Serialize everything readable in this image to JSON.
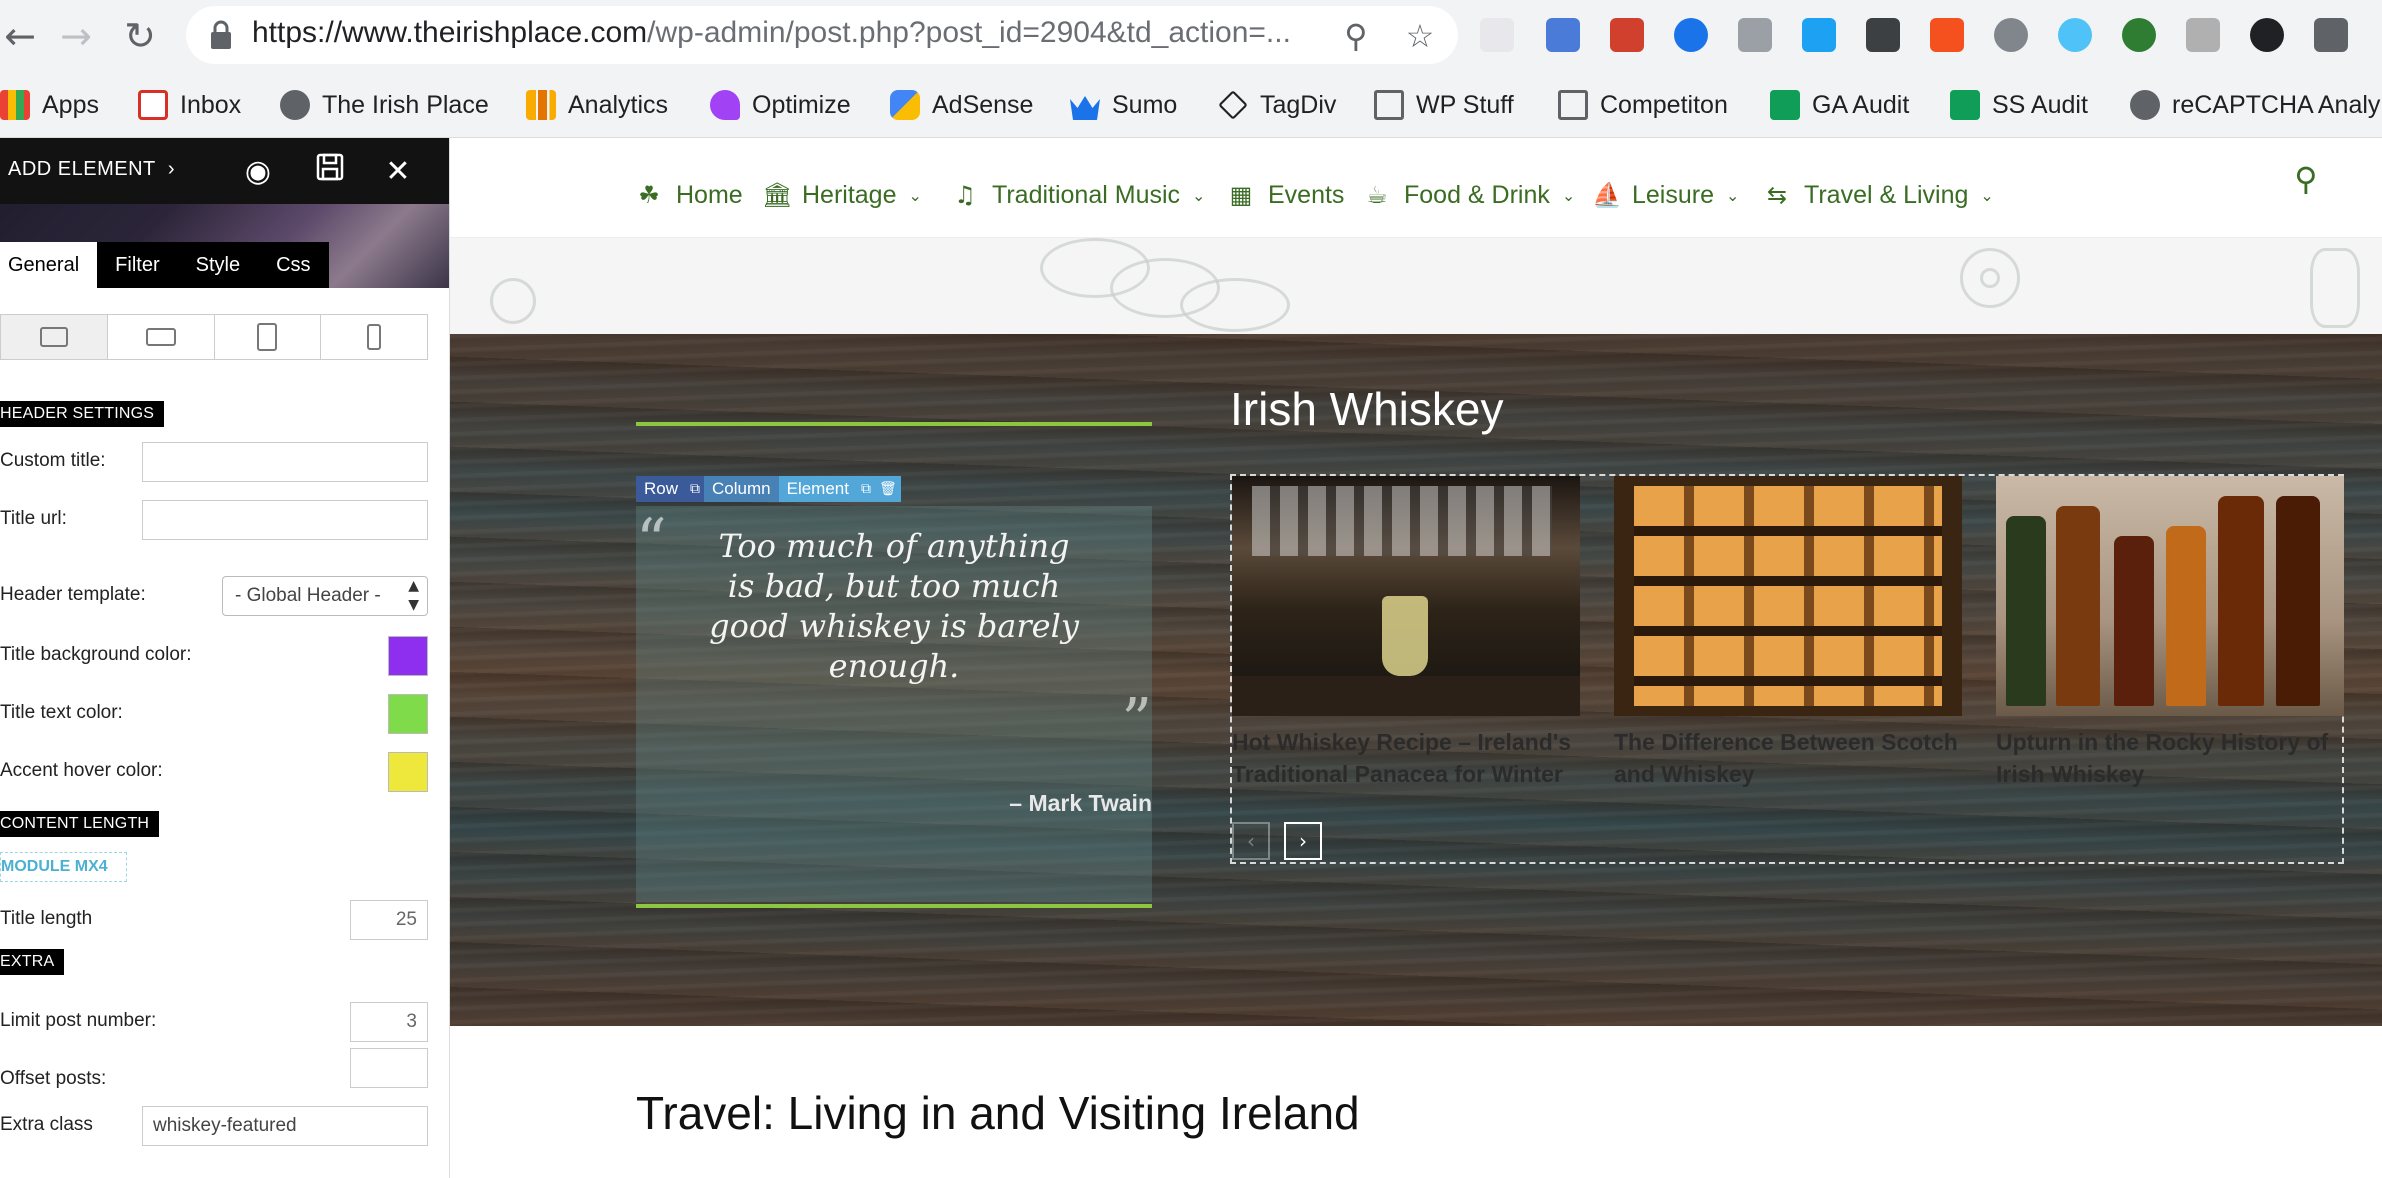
{
  "browser": {
    "url_host": "https://www.theirishplace.com",
    "url_path": "/wp-admin/post.php?post_id=2904&td_action=..."
  },
  "bookmarks": [
    {
      "label": "Apps",
      "icon": "apps-grid-icon",
      "color": "#e94235"
    },
    {
      "label": "Inbox",
      "icon": "gmail-icon",
      "color": "#d93025"
    },
    {
      "label": "The Irish Place",
      "icon": "globe-icon",
      "color": "#5f6368"
    },
    {
      "label": "Analytics",
      "icon": "analytics-icon",
      "color": "#f9ab00"
    },
    {
      "label": "Optimize",
      "icon": "optimize-icon",
      "color": "#a142f4"
    },
    {
      "label": "AdSense",
      "icon": "adsense-icon",
      "color": "#fbbc04"
    },
    {
      "label": "Sumo",
      "icon": "sumo-crown-icon",
      "color": "#1a73e8"
    },
    {
      "label": "TagDiv",
      "icon": "tagdiv-icon",
      "color": "#202124"
    },
    {
      "label": "WP Stuff",
      "icon": "folder-icon",
      "color": "#5f6368"
    },
    {
      "label": "Competiton",
      "icon": "folder-icon",
      "color": "#5f6368"
    },
    {
      "label": "GA Audit",
      "icon": "sheets-icon",
      "color": "#0f9d58"
    },
    {
      "label": "SS Audit",
      "icon": "sheets-icon",
      "color": "#0f9d58"
    },
    {
      "label": "reCAPTCHA Analy",
      "icon": "globe-icon",
      "color": "#5f6368"
    }
  ],
  "panel": {
    "title": "ADD ELEMENT",
    "chevron": "›",
    "tabs": [
      "General",
      "Filter",
      "Style",
      "Css"
    ],
    "active_tab": "General",
    "sections": {
      "header_settings": "HEADER SETTINGS",
      "content_length": "CONTENT LENGTH",
      "extra": "EXTRA"
    },
    "fields": {
      "custom_title_label": "Custom title:",
      "custom_title_value": "",
      "title_url_label": "Title url:",
      "title_url_value": "",
      "header_template_label": "Header template:",
      "header_template_value": "- Global Header -",
      "title_bg_color_label": "Title background color:",
      "title_bg_color": "#8e2ff0",
      "title_text_color_label": "Title text color:",
      "title_text_color": "#7fdb4a",
      "accent_hover_color_label": "Accent hover color:",
      "accent_hover_color": "#ede83b",
      "module_badge": "MODULE MX4",
      "title_length_label": "Title length",
      "title_length_value": "25",
      "limit_post_label": "Limit post number:",
      "limit_post_value": "3",
      "offset_posts_label": "Offset posts:",
      "offset_posts_value": "",
      "extra_class_label": "Extra class",
      "extra_class_value": "whiskey-featured"
    }
  },
  "site": {
    "nav": [
      {
        "label": "Home",
        "icon": "shamrock-icon",
        "glyph": "☘",
        "dropdown": false
      },
      {
        "label": "Heritage",
        "icon": "museum-icon",
        "glyph": "🏛",
        "dropdown": true
      },
      {
        "label": "Traditional Music",
        "icon": "harp-icon",
        "glyph": "♫",
        "dropdown": true
      },
      {
        "label": "Events",
        "icon": "calendar-icon",
        "glyph": "▦",
        "dropdown": false
      },
      {
        "label": "Food & Drink",
        "icon": "food-icon",
        "glyph": "☕",
        "dropdown": true
      },
      {
        "label": "Leisure",
        "icon": "boat-icon",
        "glyph": "⛵",
        "dropdown": true
      },
      {
        "label": "Travel & Living",
        "icon": "signpost-icon",
        "glyph": "⇆",
        "dropdown": true
      }
    ],
    "section_title": "Irish Whiskey",
    "toolbar": {
      "row": "Row",
      "column": "Column",
      "element": "Element"
    },
    "quote": {
      "text": "Too much of anything is bad, but too much good whiskey is barely enough.",
      "author": "– Mark Twain"
    },
    "cards": [
      {
        "title": "Hot Whiskey Recipe – Ireland's Traditional Panacea for Winter"
      },
      {
        "title": "The Difference Between Scotch and Whiskey"
      },
      {
        "title": "Upturn in the Rocky History of Irish Whiskey"
      }
    ],
    "next_section_title": "Travel: Living in and Visiting Ireland"
  }
}
